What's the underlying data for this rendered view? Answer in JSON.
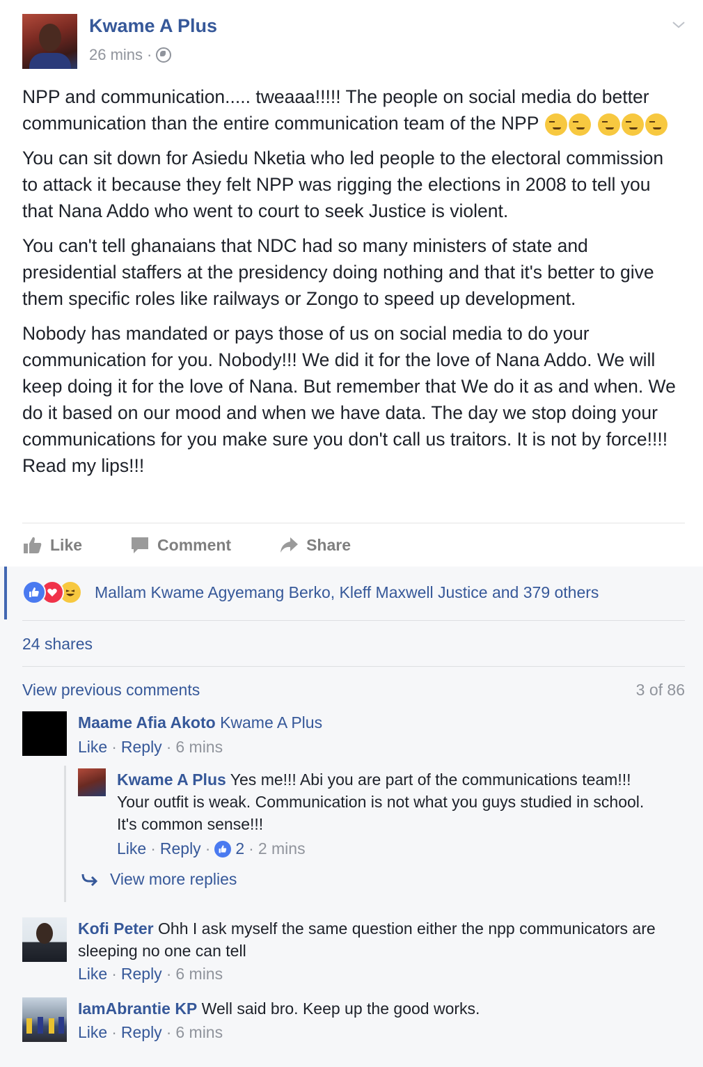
{
  "post": {
    "author": "Kwame A Plus",
    "time": "26 mins",
    "separator": "·",
    "paragraphs": [
      "NPP and communication..... tweaaa!!!!! The people on social media do better communication than the entire communication team of the NPP",
      "You can sit down for Asiedu Nketia who led people to the electoral commission to attack it because they felt NPP was rigging the elections in 2008 to tell you that Nana Addo who went to court to seek Justice is violent.",
      "You can't tell ghanaians that NDC had so many ministers of state and presidential staffers at the presidency doing nothing and that it's better to give them specific roles like railways or Zongo to speed up development.",
      "Nobody has mandated or pays those of us on social media to do your communication for you. Nobody!!! We did it for the love of Nana Addo. We will keep doing it for the love of Nana. But remember that We do it as and when. We do it based on our mood and when we have data. The day we stop doing your communications for you make sure you don't call us traitors. It is not by force!!!! Read my lips!!!"
    ],
    "emoji_icon": "smirk-emoji-icon"
  },
  "actions": {
    "like": "Like",
    "comment": "Comment",
    "share": "Share"
  },
  "feedback": {
    "reactions_text": "Mallam Kwame Agyemang Berko, Kleff Maxwell Justice and 379 others",
    "shares": "24 shares",
    "view_previous": "View previous comments",
    "count": "3 of 86",
    "view_more_replies": "View more replies"
  },
  "comments": [
    {
      "name": "Maame Afia Akoto",
      "tag": "Kwame A Plus",
      "text": "",
      "like": "Like",
      "reply": "Reply",
      "time": "6 mins"
    },
    {
      "name": "Kwame A Plus",
      "text": "Yes me!!! Abi you are part of the communications team!!! Your outfit is weak. Communication is not what you guys studied in school. It's common sense!!!",
      "like": "Like",
      "reply": "Reply",
      "likes_count": "2",
      "time": "2 mins"
    },
    {
      "name": "Kofi Peter",
      "text": "Ohh I ask myself the same question either the npp communicators are sleeping no one can tell",
      "like": "Like",
      "reply": "Reply",
      "time": "6 mins"
    },
    {
      "name": "IamAbrantie KP",
      "text": "Well said bro. Keep up the good works.",
      "like": "Like",
      "reply": "Reply",
      "time": "6 mins"
    }
  ],
  "colors": {
    "link": "#365899",
    "muted": "#90949c",
    "text": "#1d2129",
    "feedback_bg": "#f6f7f9"
  }
}
